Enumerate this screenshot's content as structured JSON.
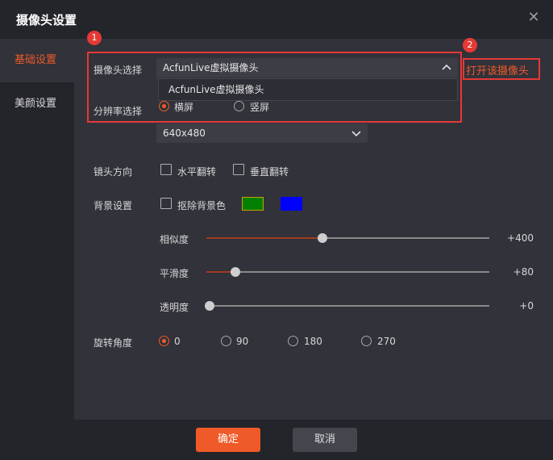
{
  "dialog": {
    "title": "摄像头设置",
    "close_icon": "close-icon"
  },
  "sidebar": {
    "items": [
      {
        "label": "基础设置",
        "active": true
      },
      {
        "label": "美颜设置",
        "active": false
      }
    ]
  },
  "annotations": {
    "badge1": "1",
    "badge2": "2"
  },
  "camera": {
    "label": "摄像头选择",
    "selected": "AcfunLive虚拟摄像头",
    "dropdown_options": [
      "AcfunLive虚拟摄像头"
    ],
    "open_link": "打开该摄像头"
  },
  "resolution": {
    "label": "分辨率选择",
    "orientation_options": [
      {
        "label": "横屏",
        "checked": true
      },
      {
        "label": "竖屏",
        "checked": false
      }
    ],
    "selected": "640x480"
  },
  "lens": {
    "label": "镜头方向",
    "options": [
      {
        "label": "水平翻转",
        "checked": false
      },
      {
        "label": "垂直翻转",
        "checked": false
      }
    ]
  },
  "background": {
    "label": "背景设置",
    "remove_bg_label": "抠除背景色",
    "remove_bg_checked": false,
    "color1": "#008000",
    "color2": "#0000ff",
    "sliders": [
      {
        "label": "相似度",
        "value_text": "+400",
        "level": 0.4
      },
      {
        "label": "平滑度",
        "value_text": "+80",
        "level": 0.09
      },
      {
        "label": "透明度",
        "value_text": "+0",
        "level": 0.0
      }
    ]
  },
  "rotation": {
    "label": "旋转角度",
    "options": [
      {
        "label": "0",
        "checked": true
      },
      {
        "label": "90",
        "checked": false
      },
      {
        "label": "180",
        "checked": false
      },
      {
        "label": "270",
        "checked": false
      }
    ]
  },
  "footer": {
    "confirm": "确定",
    "cancel": "取消"
  },
  "colors": {
    "accent": "#f05a28",
    "annotation": "#e53935"
  }
}
